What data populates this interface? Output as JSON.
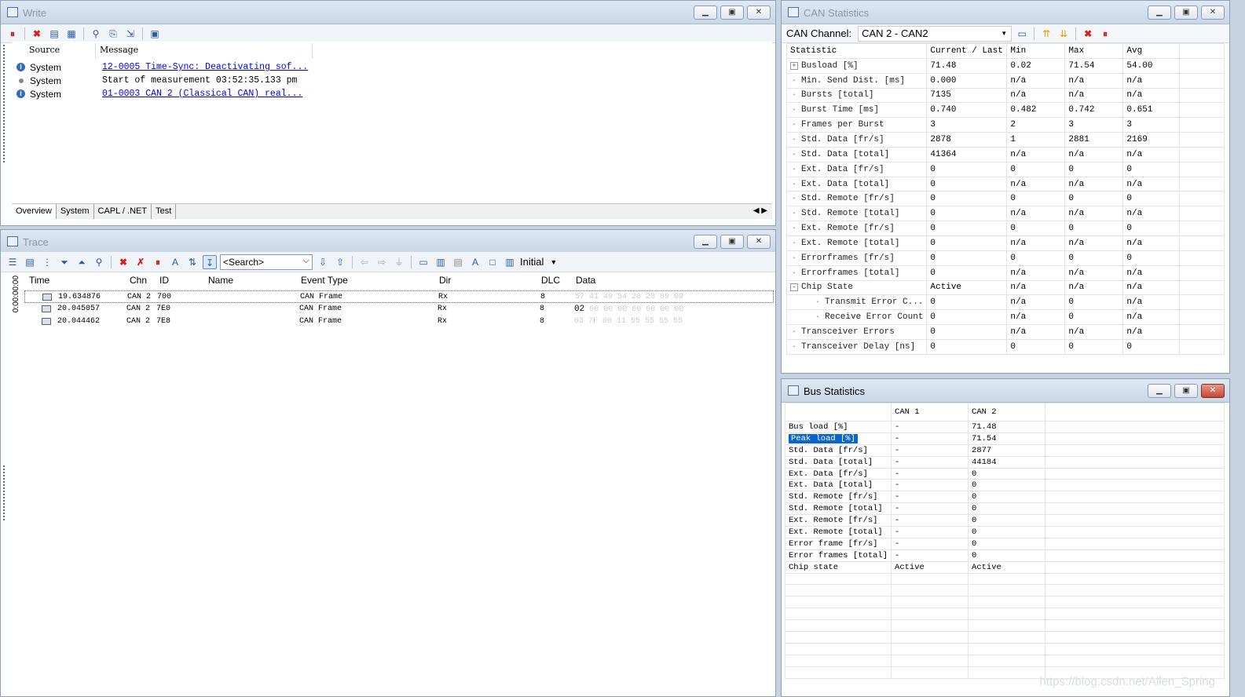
{
  "write": {
    "title": "Write",
    "cols": {
      "source": "Source",
      "message": "Message"
    },
    "rows": [
      {
        "icon": "info-icon",
        "source": "System",
        "message": "12-0005 Time-Sync: Deactivating sof...",
        "link": true
      },
      {
        "icon": "bullet-icon",
        "source": "System",
        "message": "Start of measurement 03:52:35.133 pm",
        "link": false
      },
      {
        "icon": "info-icon",
        "source": "System",
        "message": "01-0003 CAN 2 (Classical CAN)  real...",
        "link": true
      }
    ],
    "tabs": [
      "Overview",
      "System",
      "CAPL / .NET",
      "Test"
    ]
  },
  "trace": {
    "title": "Trace",
    "search_placeholder": "<Search>",
    "layout_label": "Initial",
    "time_strip": "0:00:00:00",
    "cols": [
      "Time",
      "Chn",
      "ID",
      "Name",
      "Event Type",
      "Dir",
      "DLC",
      "Data"
    ],
    "rows": [
      {
        "time": "19.634876",
        "chn": "CAN 2",
        "id": "700",
        "name": "",
        "event": "CAN Frame",
        "dir": "Rx",
        "dlc": "8",
        "data_lead": "",
        "data": "57 41 49 54 20 20 09 09"
      },
      {
        "time": "20.045057",
        "chn": "CAN 2",
        "id": "7E0",
        "name": "",
        "event": "CAN Frame",
        "dir": "Rx",
        "dlc": "8",
        "data_lead": "02",
        "data": "00 00 00 00 00 00 00"
      },
      {
        "time": "20.044462",
        "chn": "CAN 2",
        "id": "7E8",
        "name": "",
        "event": "CAN Frame",
        "dir": "Rx",
        "dlc": "8",
        "data_lead": "",
        "data": "03 7F 00 11 55 55 55 55"
      }
    ]
  },
  "canstats": {
    "title": "CAN Statistics",
    "channel_label": "CAN Channel:",
    "channel_value": "CAN 2 - CAN2",
    "cols": [
      "Statistic",
      "Current / Last",
      "Min",
      "Max",
      "Avg"
    ],
    "rows": [
      {
        "name": "Busload [%]",
        "cur": "71.48",
        "min": "0.02",
        "max": "71.54",
        "avg": "54.00",
        "lvl": 0,
        "exp": "+"
      },
      {
        "name": "Min. Send Dist. [ms]",
        "cur": "0.000",
        "min": "n/a",
        "max": "n/a",
        "avg": "n/a",
        "lvl": 0,
        "exp": ""
      },
      {
        "name": "Bursts [total]",
        "cur": "7135",
        "min": "n/a",
        "max": "n/a",
        "avg": "n/a",
        "lvl": 0,
        "exp": ""
      },
      {
        "name": "Burst Time [ms]",
        "cur": "0.740",
        "min": "0.482",
        "max": "0.742",
        "avg": "0.651",
        "lvl": 0,
        "exp": ""
      },
      {
        "name": "Frames per Burst",
        "cur": "3",
        "min": "2",
        "max": "3",
        "avg": "3",
        "lvl": 0,
        "exp": ""
      },
      {
        "name": "Std. Data [fr/s]",
        "cur": "2878",
        "min": "1",
        "max": "2881",
        "avg": "2169",
        "lvl": 0,
        "exp": ""
      },
      {
        "name": "Std. Data [total]",
        "cur": "41364",
        "min": "n/a",
        "max": "n/a",
        "avg": "n/a",
        "lvl": 0,
        "exp": ""
      },
      {
        "name": "Ext. Data [fr/s]",
        "cur": "0",
        "min": "0",
        "max": "0",
        "avg": "0",
        "lvl": 0,
        "exp": ""
      },
      {
        "name": "Ext. Data [total]",
        "cur": "0",
        "min": "n/a",
        "max": "n/a",
        "avg": "n/a",
        "lvl": 0,
        "exp": ""
      },
      {
        "name": "Std. Remote [fr/s]",
        "cur": "0",
        "min": "0",
        "max": "0",
        "avg": "0",
        "lvl": 0,
        "exp": ""
      },
      {
        "name": "Std. Remote [total]",
        "cur": "0",
        "min": "n/a",
        "max": "n/a",
        "avg": "n/a",
        "lvl": 0,
        "exp": ""
      },
      {
        "name": "Ext. Remote [fr/s]",
        "cur": "0",
        "min": "0",
        "max": "0",
        "avg": "0",
        "lvl": 0,
        "exp": ""
      },
      {
        "name": "Ext. Remote [total]",
        "cur": "0",
        "min": "n/a",
        "max": "n/a",
        "avg": "n/a",
        "lvl": 0,
        "exp": ""
      },
      {
        "name": "Errorframes [fr/s]",
        "cur": "0",
        "min": "0",
        "max": "0",
        "avg": "0",
        "lvl": 0,
        "exp": ""
      },
      {
        "name": "Errorframes [total]",
        "cur": "0",
        "min": "n/a",
        "max": "n/a",
        "avg": "n/a",
        "lvl": 0,
        "exp": ""
      },
      {
        "name": "Chip State",
        "cur": "Active",
        "min": "n/a",
        "max": "n/a",
        "avg": "n/a",
        "lvl": 0,
        "exp": "-"
      },
      {
        "name": "Transmit Error C...",
        "cur": "0",
        "min": "n/a",
        "max": "0",
        "avg": "n/a",
        "lvl": 1,
        "exp": ""
      },
      {
        "name": "Receive Error Count",
        "cur": "0",
        "min": "n/a",
        "max": "0",
        "avg": "n/a",
        "lvl": 1,
        "exp": ""
      },
      {
        "name": "Transceiver Errors",
        "cur": "0",
        "min": "n/a",
        "max": "n/a",
        "avg": "n/a",
        "lvl": 0,
        "exp": ""
      },
      {
        "name": "Transceiver Delay [ns]",
        "cur": "0",
        "min": "0",
        "max": "0",
        "avg": "0",
        "lvl": 0,
        "exp": ""
      }
    ]
  },
  "busstats": {
    "title": "Bus Statistics",
    "cols": [
      "",
      "CAN 1",
      "CAN 2"
    ],
    "rows": [
      {
        "name": "Bus load [%]",
        "c1": "-",
        "c2": "71.48"
      },
      {
        "name": "Peak load [%]",
        "c1": "-",
        "c2": "71.54",
        "sel": true
      },
      {
        "name": "Std. Data [fr/s]",
        "c1": "-",
        "c2": "2877"
      },
      {
        "name": "Std. Data [total]",
        "c1": "-",
        "c2": "44184"
      },
      {
        "name": "Ext. Data [fr/s]",
        "c1": "-",
        "c2": "0"
      },
      {
        "name": "Ext. Data [total]",
        "c1": "-",
        "c2": "0"
      },
      {
        "name": "Std. Remote [fr/s]",
        "c1": "-",
        "c2": "0"
      },
      {
        "name": "Std. Remote [total]",
        "c1": "-",
        "c2": "0"
      },
      {
        "name": "Ext. Remote [fr/s]",
        "c1": "-",
        "c2": "0"
      },
      {
        "name": "Ext. Remote [total]",
        "c1": "-",
        "c2": "0"
      },
      {
        "name": "Error frame [fr/s]",
        "c1": "-",
        "c2": "0"
      },
      {
        "name": "Error frames [total]",
        "c1": "-",
        "c2": "0"
      },
      {
        "name": "Chip state",
        "c1": "Active",
        "c2": "Active"
      }
    ]
  },
  "watermark": "https://blog.csdn.net/Allen_Spring"
}
